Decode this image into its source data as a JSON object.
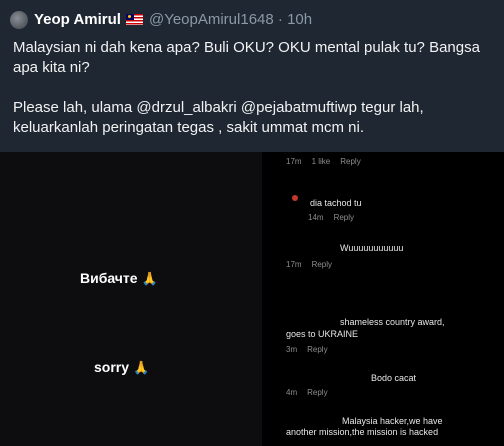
{
  "tweet": {
    "display_name": "Yeop Amirul",
    "flag": "malaysia-flag",
    "handle": "@YeopAmirul1648",
    "separator": "·",
    "time": "10h",
    "line1": "Malaysian ni dah kena apa? Buli OKU? OKU mental pulak tu? Bangsa apa kita ni?",
    "line2": "Please lah, ulama @drzul_albakri @pejabatmuftiwp tegur lah, keluarkanlah peringatan tegas , sakit ummat mcm ni."
  },
  "media": {
    "left_captions": {
      "caption1": "Вибачте",
      "caption2": "sorry",
      "emoji": "🙏"
    },
    "comments": [
      {
        "meta": [
          "17m",
          "1 like",
          "Reply"
        ]
      },
      {
        "text": "dia tachod tu",
        "meta": [
          "14m",
          "Reply"
        ]
      },
      {
        "text": "Wuuuuuuuuuuu",
        "meta": [
          "17m",
          "Reply"
        ]
      },
      {
        "text": "shameless country award,",
        "text2": "goes to UKRAINE",
        "meta": [
          "3m",
          "Reply"
        ]
      },
      {
        "text": "Bodo cacat",
        "meta": [
          "4m",
          "Reply"
        ]
      },
      {
        "text": "Malaysia hacker,we have",
        "text2": "another mission,the mission is hacked"
      }
    ]
  }
}
